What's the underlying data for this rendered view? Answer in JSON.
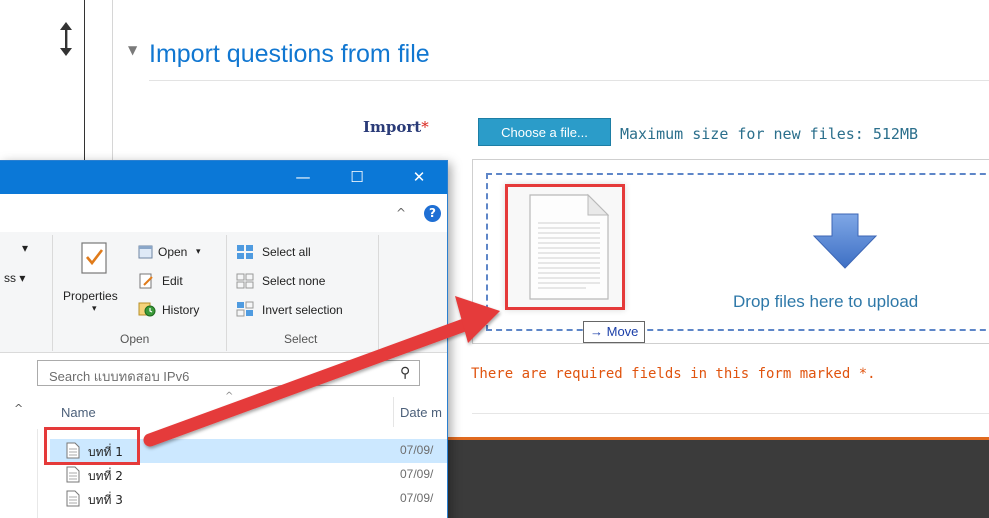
{
  "page": {
    "section_title": "Import questions from file",
    "import_label": "Import",
    "required_marker": "*",
    "choose_button": "Choose a file...",
    "max_size_text": "Maximum size for new files: 512MB",
    "drop_text": "Drop files here to upload",
    "move_label": "Move",
    "required_message": "There are required fields in this form marked *."
  },
  "explorer": {
    "title_buttons": {
      "minimize": "—",
      "maximize": "☐",
      "close": "✕"
    },
    "ribbon": {
      "partial_left_1": "▾",
      "partial_left_2": "ss ▾",
      "properties": "Properties",
      "properties_caret": "▾",
      "open": "Open",
      "open_caret": "▾",
      "edit": "Edit",
      "history": "History",
      "select_all": "Select all",
      "select_none": "Select none",
      "invert_selection": "Invert selection",
      "group_open": "Open",
      "group_select": "Select"
    },
    "search_placeholder": "Search แบบทดสอบ IPv6",
    "columns": {
      "name": "Name",
      "date": "Date m"
    },
    "files": [
      {
        "name": "บทที่ 1",
        "date": "07/09/",
        "selected": true
      },
      {
        "name": "บทที่ 2",
        "date": "07/09/",
        "selected": false
      },
      {
        "name": "บทที่ 3",
        "date": "07/09/",
        "selected": false
      }
    ]
  },
  "colors": {
    "link_blue": "#1177d1",
    "button_blue": "#2b9cc9",
    "required_red": "#d9251c",
    "warning_orange": "#e0540f",
    "annotation_red": "#e53a3a",
    "title_bar_blue": "#0b78d7"
  }
}
